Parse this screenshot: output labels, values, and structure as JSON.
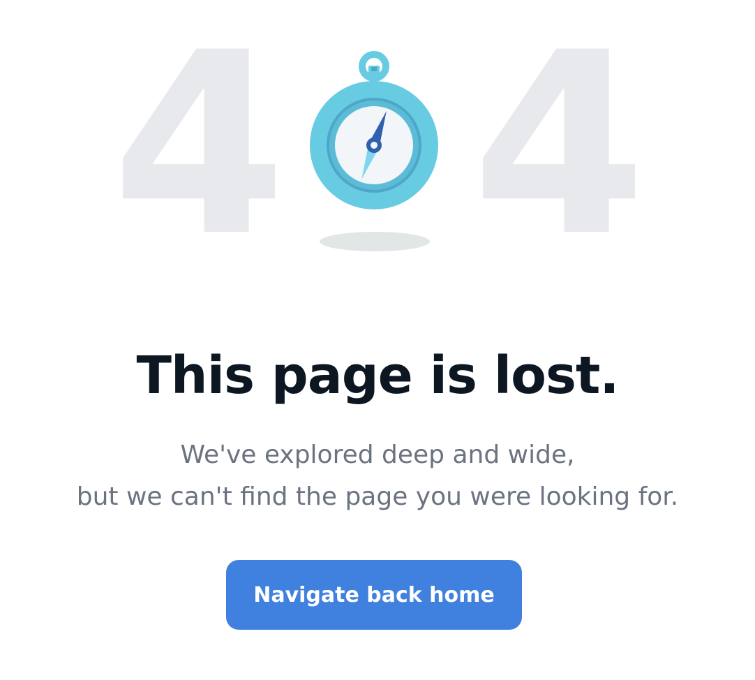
{
  "hero": {
    "digit_left": "4",
    "digit_right": "4",
    "illustration_icon": "compass-icon"
  },
  "title": "This page is lost.",
  "subtitle": {
    "line1": "We've explored deep and wide,",
    "line2": "but we can't find the page you were looking for."
  },
  "button": {
    "label": "Navigate back home"
  },
  "colors": {
    "background": "#ffffff",
    "digit": "#e8e9ec",
    "title": "#0d1722",
    "subtitle": "#6b7280",
    "button": "#4080de",
    "compass_ring": "#67cbe2",
    "compass_inner_ring": "#4fa7c7",
    "compass_face": "#f2f6f8",
    "needle_dark": "#2f5fae",
    "needle_light": "#7fd6ec"
  }
}
